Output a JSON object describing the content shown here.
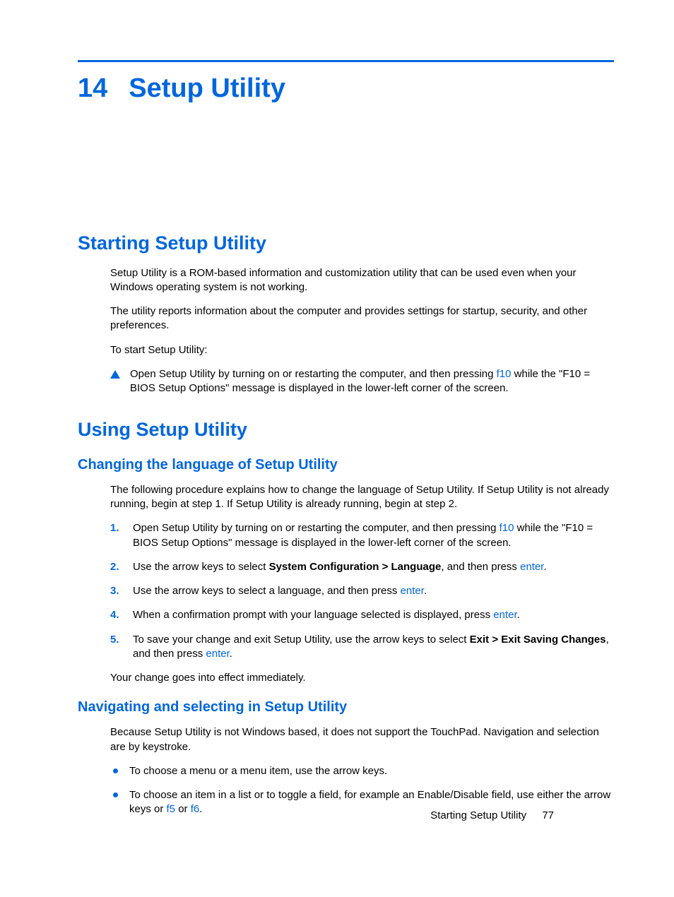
{
  "chapter": {
    "number": "14",
    "title": "Setup Utility"
  },
  "section1": {
    "heading": "Starting Setup Utility",
    "p1": "Setup Utility is a ROM-based information and customization utility that can be used even when your Windows operating system is not working.",
    "p2": "The utility reports information about the computer and provides settings for startup, security, and other preferences.",
    "p3": "To start Setup Utility:",
    "triA": "Open Setup Utility by turning on or restarting the computer, and then pressing ",
    "triKey": "f10",
    "triB": " while the \"F10 = BIOS Setup Options\" message is displayed in the lower-left corner of the screen."
  },
  "section2": {
    "heading": "Using Setup Utility",
    "sub1": {
      "heading": "Changing the language of Setup Utility",
      "intro": "The following procedure explains how to change the language of Setup Utility. If Setup Utility is not already running, begin at step 1. If Setup Utility is already running, begin at step 2.",
      "steps": {
        "n1": "1.",
        "s1a": "Open Setup Utility by turning on or restarting the computer, and then pressing ",
        "s1key": "f10",
        "s1b": " while the \"F10 = BIOS Setup Options\" message is displayed in the lower-left corner of the screen.",
        "n2": "2.",
        "s2a": "Use the arrow keys to select ",
        "s2bold": "System Configuration > Language",
        "s2b": ", and then press ",
        "s2key": "enter",
        "s2c": ".",
        "n3": "3.",
        "s3a": "Use the arrow keys to select a language, and then press ",
        "s3key": "enter",
        "s3b": ".",
        "n4": "4.",
        "s4a": "When a confirmation prompt with your language selected is displayed, press ",
        "s4key": "enter",
        "s4b": ".",
        "n5": "5.",
        "s5a": "To save your change and exit Setup Utility, use the arrow keys to select ",
        "s5bold": "Exit > Exit Saving Changes",
        "s5b": ", and then press ",
        "s5key": "enter",
        "s5c": "."
      },
      "outro": "Your change goes into effect immediately."
    },
    "sub2": {
      "heading": "Navigating and selecting in Setup Utility",
      "intro": "Because Setup Utility is not Windows based, it does not support the TouchPad. Navigation and selection are by keystroke.",
      "b1": "To choose a menu or a menu item, use the arrow keys.",
      "b2a": "To choose an item in a list or to toggle a field, for example an Enable/Disable field, use either the arrow keys or ",
      "b2k1": "f5",
      "b2mid": " or ",
      "b2k2": "f6",
      "b2b": "."
    }
  },
  "footer": {
    "text": "Starting Setup Utility",
    "page": "77"
  }
}
